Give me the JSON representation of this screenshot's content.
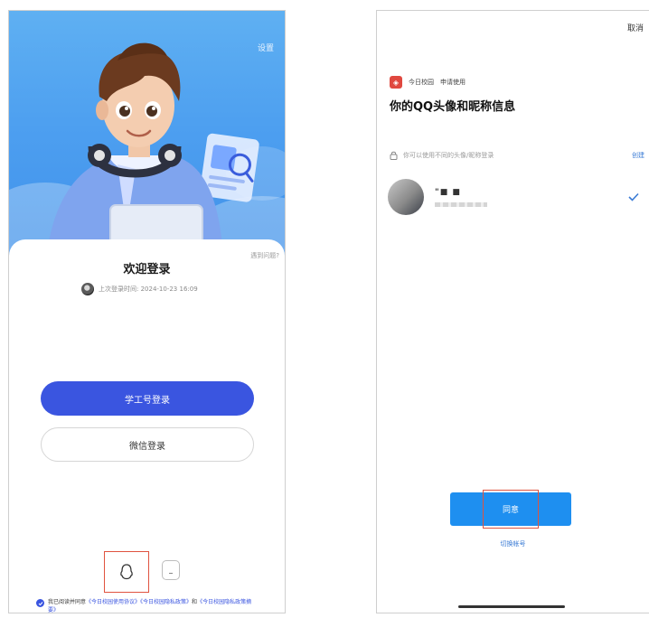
{
  "left_screen": {
    "settings_label": "设置",
    "help_label": "遇到问题?",
    "welcome_title": "欢迎登录",
    "last_login_text": "上次登录时间: 2024-10-23 16:09",
    "primary_button_label": "学工号登录",
    "secondary_button_label": "微信登录",
    "agreement_prefix": "我已阅读并同意",
    "agreement_terms": "《今日校园使用协议》",
    "agreement_privacy": "《今日校园隐私政策》",
    "agreement_joiner": "和",
    "agreement_privacy_summary": "《今日校园隐私政策摘要》",
    "colors": {
      "primary": "#3a55e0",
      "highlight": "#e0533f",
      "hero": "#4d9ff0"
    }
  },
  "right_screen": {
    "cancel_label": "取消",
    "app_name": "今日校园",
    "request_text": "申请使用",
    "permission_title": "你的QQ头像和昵称信息",
    "hint_text": "你可以使用不同的头像/昵称登录",
    "create_label": "创建",
    "account_name": "\"■ ■",
    "agree_button_label": "同意",
    "switch_account_label": "切换帐号",
    "colors": {
      "accent": "#1e8ff0",
      "check": "#3a7bd5"
    }
  }
}
